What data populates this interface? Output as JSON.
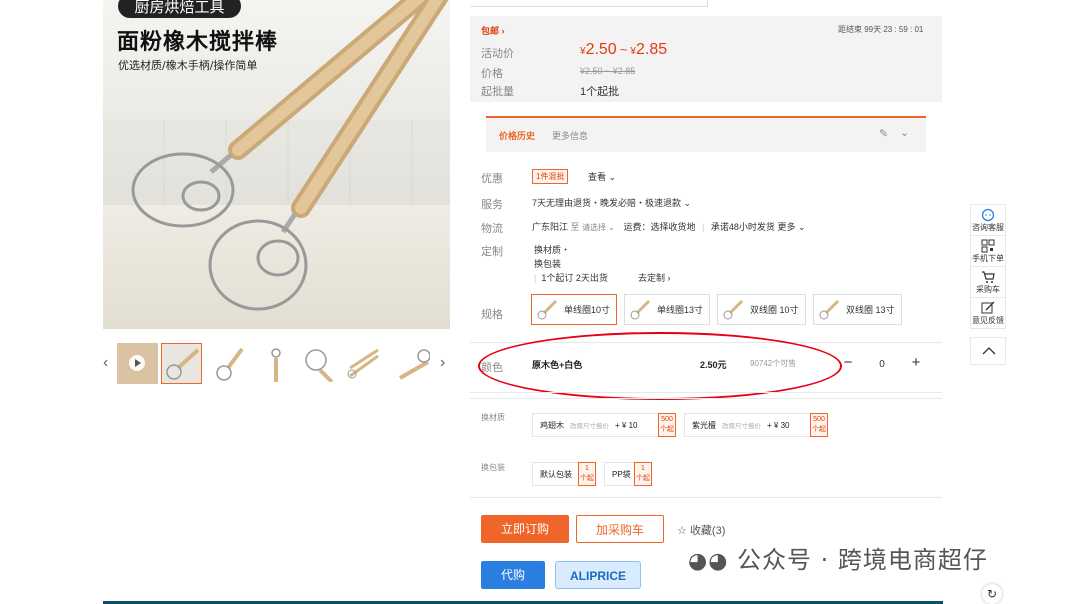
{
  "hero": {
    "badge": "厨房烘焙工具",
    "title": "面粉橡木搅拌棒",
    "subtitle": "优选材质/橡木手柄/操作简单"
  },
  "price": {
    "shipping": "包邮",
    "countdown": "距结束 99天 23 : 59 : 01",
    "activity_label": "活动价",
    "activity_price_low": "2.50",
    "activity_price_high": "2.85",
    "currency": "¥",
    "tilde": "~",
    "orig_label": "价格",
    "orig_price": "¥2.50 ~ ¥2.85",
    "moq_label": "起批量",
    "moq_value": "1个起批"
  },
  "history": {
    "tab_active": "价格历史",
    "tab_other": "更多信息"
  },
  "promo": {
    "label": "优惠",
    "tag": "1件混批",
    "link": "查看"
  },
  "service": {
    "label": "服务",
    "text": "7天无理由退货・晚发必赔・极速退款"
  },
  "logistics": {
    "label": "物流",
    "from": "广东阳江",
    "to_label": "至",
    "to_select": "请选择",
    "freight": "运费：选择收货地",
    "promise": "承诺48小时发货",
    "more": "更多"
  },
  "custom": {
    "label": "定制",
    "line1": "换材质・",
    "line2": "换包装",
    "line3": "1个起订 2天出货",
    "link": "去定制"
  },
  "spec": {
    "label": "规格",
    "options": [
      "单线圈10寸",
      "单线圈13寸",
      "双线圈 10寸",
      "双线圈 13寸"
    ]
  },
  "color_row": {
    "label": "颜色",
    "name": "原木色+白色",
    "price": "2.50元",
    "stock": "90742个可售",
    "minus": "−",
    "qty": "0",
    "plus": "+"
  },
  "material": {
    "label": "换材质",
    "options": [
      {
        "name": "鸡翅木",
        "hint": "改原尺寸报价",
        "add": "+ ¥ 10",
        "moq1": "500",
        "moq2": "个起"
      },
      {
        "name": "紫光檀",
        "hint": "改原尺寸报价",
        "add": "+ ¥ 30",
        "moq1": "500",
        "moq2": "个起"
      }
    ]
  },
  "packaging": {
    "label": "换包装",
    "options": [
      {
        "name": "默认包装",
        "moq1": "1",
        "moq2": "个起"
      },
      {
        "name": "PP袋",
        "moq1": "1",
        "moq2": "个起"
      }
    ]
  },
  "actions": {
    "buy": "立即订购",
    "cart": "加采购车",
    "fav": "收藏(3)",
    "daigou": "代购",
    "aliprice": "ALIPRICE"
  },
  "side": {
    "consult": "咨询客服",
    "mobile": "手机下单",
    "cart": "采购车",
    "feedback": "意见反馈"
  },
  "watermark": "公众号 · 跨境电商超仔",
  "colors": {
    "accent": "#f0652a",
    "price_red": "#e23c0d",
    "blue": "#2b7fe0",
    "highlight_oval": "#e60012"
  }
}
